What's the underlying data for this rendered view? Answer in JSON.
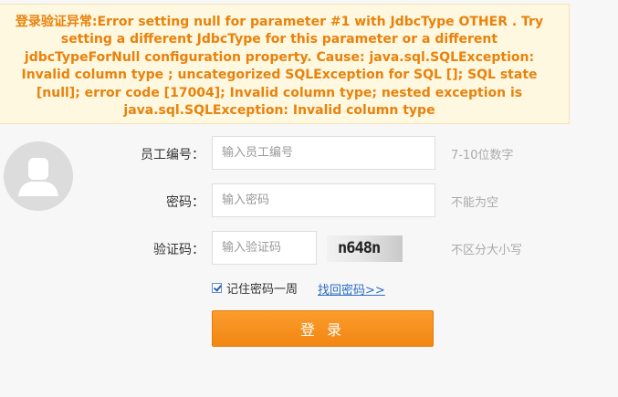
{
  "error": {
    "message": "登录验证异常:Error setting null for parameter #1 with JdbcType OTHER . Try setting a different JdbcType for this parameter or a different jdbcTypeForNull configuration property. Cause: java.sql.SQLException: Invalid column type ; uncategorized SQLException for SQL []; SQL state [null]; error code [17004]; Invalid column type; nested exception is java.sql.SQLException: Invalid column type"
  },
  "form": {
    "employee_id": {
      "label": "员工编号：",
      "placeholder": "输入员工编号",
      "hint": "7-10位数字"
    },
    "password": {
      "label": "密码：",
      "placeholder": "输入密码",
      "hint": "不能为空"
    },
    "captcha": {
      "label": "验证码：",
      "placeholder": "输入验证码",
      "hint": "不区分大小写",
      "image_text": "n648n"
    },
    "remember": {
      "label": "记住密码一周",
      "checked": true
    },
    "forgot_link": "找回密码>>",
    "login_button": "登 录"
  },
  "colors": {
    "accent": "#f28612",
    "error": "#e8820c",
    "link": "#2b6dc2"
  }
}
